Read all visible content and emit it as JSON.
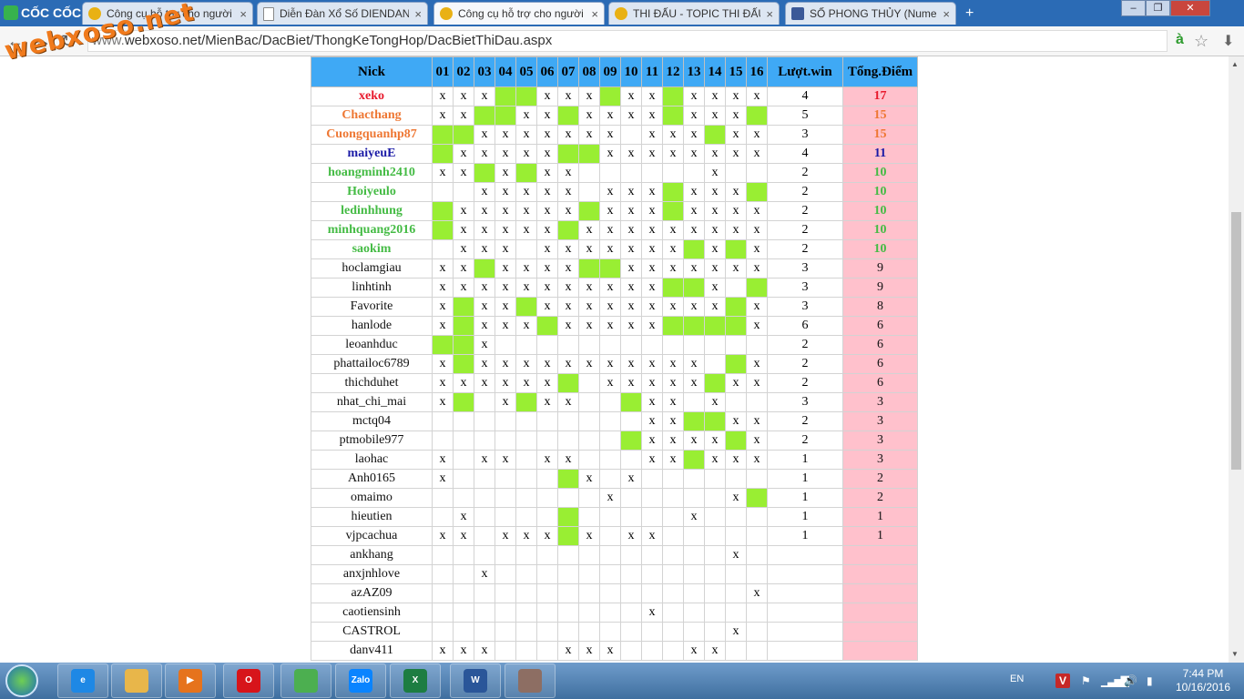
{
  "browser": {
    "logo_text": "CỐC CỐC",
    "tabs": [
      {
        "label": "Công cụ hỗ trợ cho người",
        "icon": "xoso-favicon"
      },
      {
        "label": "Diễn Đàn Xổ Số DIENDAN",
        "icon": "document-favicon"
      },
      {
        "label": "Công cụ hỗ trợ cho người",
        "icon": "xoso-favicon",
        "active": true
      },
      {
        "label": "THI ĐẤU - TOPIC THI ĐẤU",
        "icon": "xoso-favicon"
      },
      {
        "label": "SỐ PHONG THỦY (Numer",
        "icon": "facebook-favicon"
      }
    ],
    "tab_close": "×",
    "new_tab": "+",
    "window_buttons": {
      "minimize": "–",
      "restore": "❐",
      "close": "✕"
    },
    "nav": {
      "back": "←",
      "forward": "→",
      "reload": "↻"
    },
    "url_prefix": "www.",
    "url": "webxoso.net/MienBac/DacBiet/ThongKeTongHop/DacBietThiDau.aspx",
    "watermark": "webxoso.net",
    "address_icons": {
      "translate": "à",
      "bookmark": "☆",
      "download": "⬇"
    }
  },
  "colors": {
    "header": "#3fa9f5",
    "hit": "#99ee33",
    "total_bg": "#ffc1cc"
  },
  "table": {
    "headers": [
      "Nick",
      "01",
      "02",
      "03",
      "04",
      "05",
      "06",
      "07",
      "08",
      "09",
      "10",
      "11",
      "12",
      "13",
      "14",
      "15",
      "16",
      "Lượt.win",
      "Tổng.Điểm"
    ],
    "rows": [
      {
        "nick": "xeko",
        "color": "#e8192c",
        "cells": "xxxggxxxgxxgxxxx",
        "wins": "4",
        "total": "17"
      },
      {
        "nick": "Chacthang",
        "color": "#ee7733",
        "cells": "xxggxxgxxxxgxxxg",
        "wins": "5",
        "total": "15"
      },
      {
        "nick": "Cuongquanhp87",
        "color": "#ee7733",
        "cells": "ggxxxxxxx_xxxgxx",
        "wins": "3",
        "total": "15"
      },
      {
        "nick": "maiyeuE",
        "color": "#1a1aa6",
        "cells": "gxxxxxggxxxxxxxx",
        "wins": "4",
        "total": "11"
      },
      {
        "nick": "hoangminh2410",
        "color": "#44bb44",
        "cells": "xxgxgxx______x__",
        "wins": "2",
        "total": "10"
      },
      {
        "nick": "Hoiyeulo",
        "color": "#44bb44",
        "cells": "__xxxxx_xxxgxxxg",
        "wins": "2",
        "total": "10"
      },
      {
        "nick": "ledinhhung",
        "color": "#44bb44",
        "cells": "gxxxxxxgxxxgxxxx",
        "wins": "2",
        "total": "10"
      },
      {
        "nick": "minhquang2016",
        "color": "#44bb44",
        "cells": "gxxxxxgxxxxxxxxx",
        "wins": "2",
        "total": "10"
      },
      {
        "nick": "saokim",
        "color": "#44bb44",
        "cells": "_xxx_xxxxxxxgxgx",
        "wins": "2",
        "total": "10"
      },
      {
        "nick": "hoclamgiau",
        "color": "#111111",
        "cells": "xxgxxxxggxxxxxxx",
        "wins": "3",
        "total": "9"
      },
      {
        "nick": "linhtinh",
        "color": "#111111",
        "cells": "xxxxxxxxxxxggx_g",
        "wins": "3",
        "total": "9"
      },
      {
        "nick": "Favorite",
        "color": "#111111",
        "cells": "xgxxgxxxxxxxxxgx",
        "wins": "3",
        "total": "8"
      },
      {
        "nick": "hanlode",
        "color": "#111111",
        "cells": "xgxxxgxxxxxggggx",
        "wins": "6",
        "total": "6"
      },
      {
        "nick": "leoanhduc",
        "color": "#111111",
        "cells": "ggx_____________",
        "wins": "2",
        "total": "6"
      },
      {
        "nick": "phattailoc6789",
        "color": "#111111",
        "cells": "xgxxxxxxxxxxx_gx",
        "wins": "2",
        "total": "6"
      },
      {
        "nick": "thichduhet",
        "color": "#111111",
        "cells": "xxxxxxg_xxxxxgxx",
        "wins": "2",
        "total": "6"
      },
      {
        "nick": "nhat_chi_mai",
        "color": "#111111",
        "cells": "xg_xgxx__gxx_x__",
        "wins": "3",
        "total": "3"
      },
      {
        "nick": "mctq04",
        "color": "#111111",
        "cells": "__________xxggxx",
        "wins": "2",
        "total": "3"
      },
      {
        "nick": "ptmobile977",
        "color": "#111111",
        "cells": "_________gxxxxgx",
        "wins": "2",
        "total": "3"
      },
      {
        "nick": "laohac",
        "color": "#111111",
        "cells": "x_xx_xx___xxgxxx",
        "wins": "1",
        "total": "3"
      },
      {
        "nick": "Anh0165",
        "color": "#111111",
        "cells": "x_____gx_x______",
        "wins": "1",
        "total": "2"
      },
      {
        "nick": "omaimo",
        "color": "#111111",
        "cells": "________x_____xg",
        "wins": "1",
        "total": "2"
      },
      {
        "nick": "hieutien",
        "color": "#111111",
        "cells": "_x____g_____x___",
        "wins": "1",
        "total": "1"
      },
      {
        "nick": "vjpcachua",
        "color": "#111111",
        "cells": "xx_xxxgx_xx_____",
        "wins": "1",
        "total": "1"
      },
      {
        "nick": "ankhang",
        "color": "#111111",
        "cells": "______________x_",
        "wins": "",
        "total": ""
      },
      {
        "nick": "anxjnhlove",
        "color": "#111111",
        "cells": "__x_____________",
        "wins": "",
        "total": ""
      },
      {
        "nick": "azAZ09",
        "color": "#111111",
        "cells": "_______________x",
        "wins": "",
        "total": ""
      },
      {
        "nick": "caotiensinh",
        "color": "#111111",
        "cells": "__________x_____",
        "wins": "",
        "total": ""
      },
      {
        "nick": "CASTROL",
        "color": "#111111",
        "cells": "______________x_",
        "wins": "",
        "total": ""
      },
      {
        "nick": "danv411",
        "color": "#111111",
        "cells": "xxx___xxx___xx__",
        "wins": "",
        "total": ""
      }
    ]
  },
  "taskbar": {
    "apps": [
      {
        "name": "internet-explorer",
        "label": "e",
        "color": "#1e88e5"
      },
      {
        "name": "file-explorer",
        "label": "",
        "color": "#e8b64a"
      },
      {
        "name": "media-player",
        "label": "▶",
        "color": "#e6731c"
      },
      {
        "name": "opera",
        "label": "O",
        "color": "#d7141a"
      },
      {
        "name": "coccoc",
        "label": "",
        "color": "#4caf50"
      },
      {
        "name": "zalo",
        "label": "Zalo",
        "color": "#0a84ff"
      },
      {
        "name": "excel",
        "label": "X",
        "color": "#1d7d42"
      },
      {
        "name": "word",
        "label": "W",
        "color": "#2a5699"
      },
      {
        "name": "paint",
        "label": "",
        "color": "#8d6e63"
      }
    ],
    "lang": "EN",
    "time": "7:44 PM",
    "date": "10/16/2016"
  }
}
